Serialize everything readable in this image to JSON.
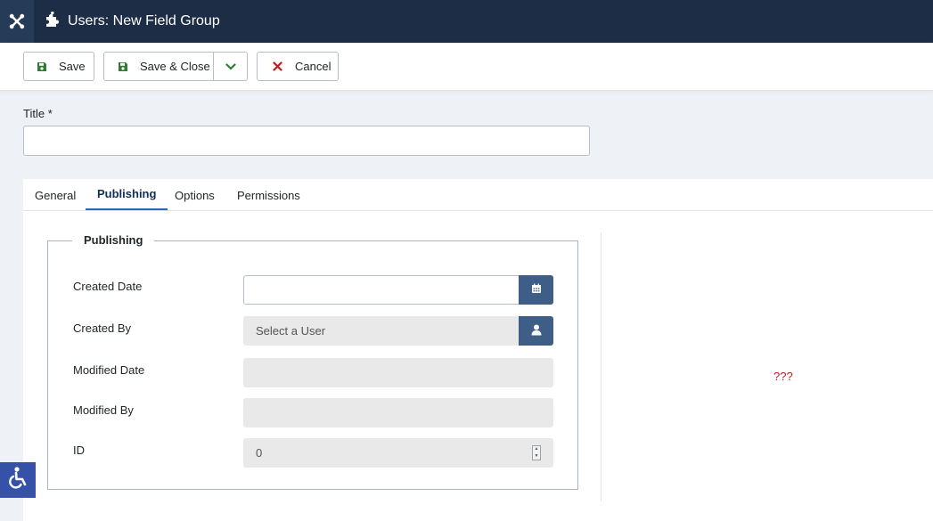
{
  "header": {
    "title": "Users: New Field Group",
    "logo_icon": "joomla-logo-icon",
    "title_icon": "puzzle-icon"
  },
  "toolbar": {
    "save_label": "Save",
    "save_close_label": "Save & Close",
    "cancel_label": "Cancel"
  },
  "form": {
    "title_label": "Title *",
    "title_value": ""
  },
  "tabs": [
    {
      "label": "General",
      "active": false
    },
    {
      "label": "Publishing",
      "active": true
    },
    {
      "label": "Options",
      "active": false
    },
    {
      "label": "Permissions",
      "active": false
    }
  ],
  "publishing": {
    "legend": "Publishing",
    "created_date_label": "Created Date",
    "created_date_value": "",
    "created_by_label": "Created By",
    "created_by_placeholder": "Select a User",
    "modified_date_label": "Modified Date",
    "modified_date_value": "",
    "modified_by_label": "Modified By",
    "modified_by_value": "",
    "id_label": "ID",
    "id_value": "0"
  },
  "right_pane": {
    "text": "???"
  },
  "colors": {
    "header_bg": "#1c2d45",
    "accent": "#3f5e87",
    "tab_underline": "#2a69b8",
    "save_icon": "#2f7d32",
    "cancel_icon": "#c21a1a"
  }
}
